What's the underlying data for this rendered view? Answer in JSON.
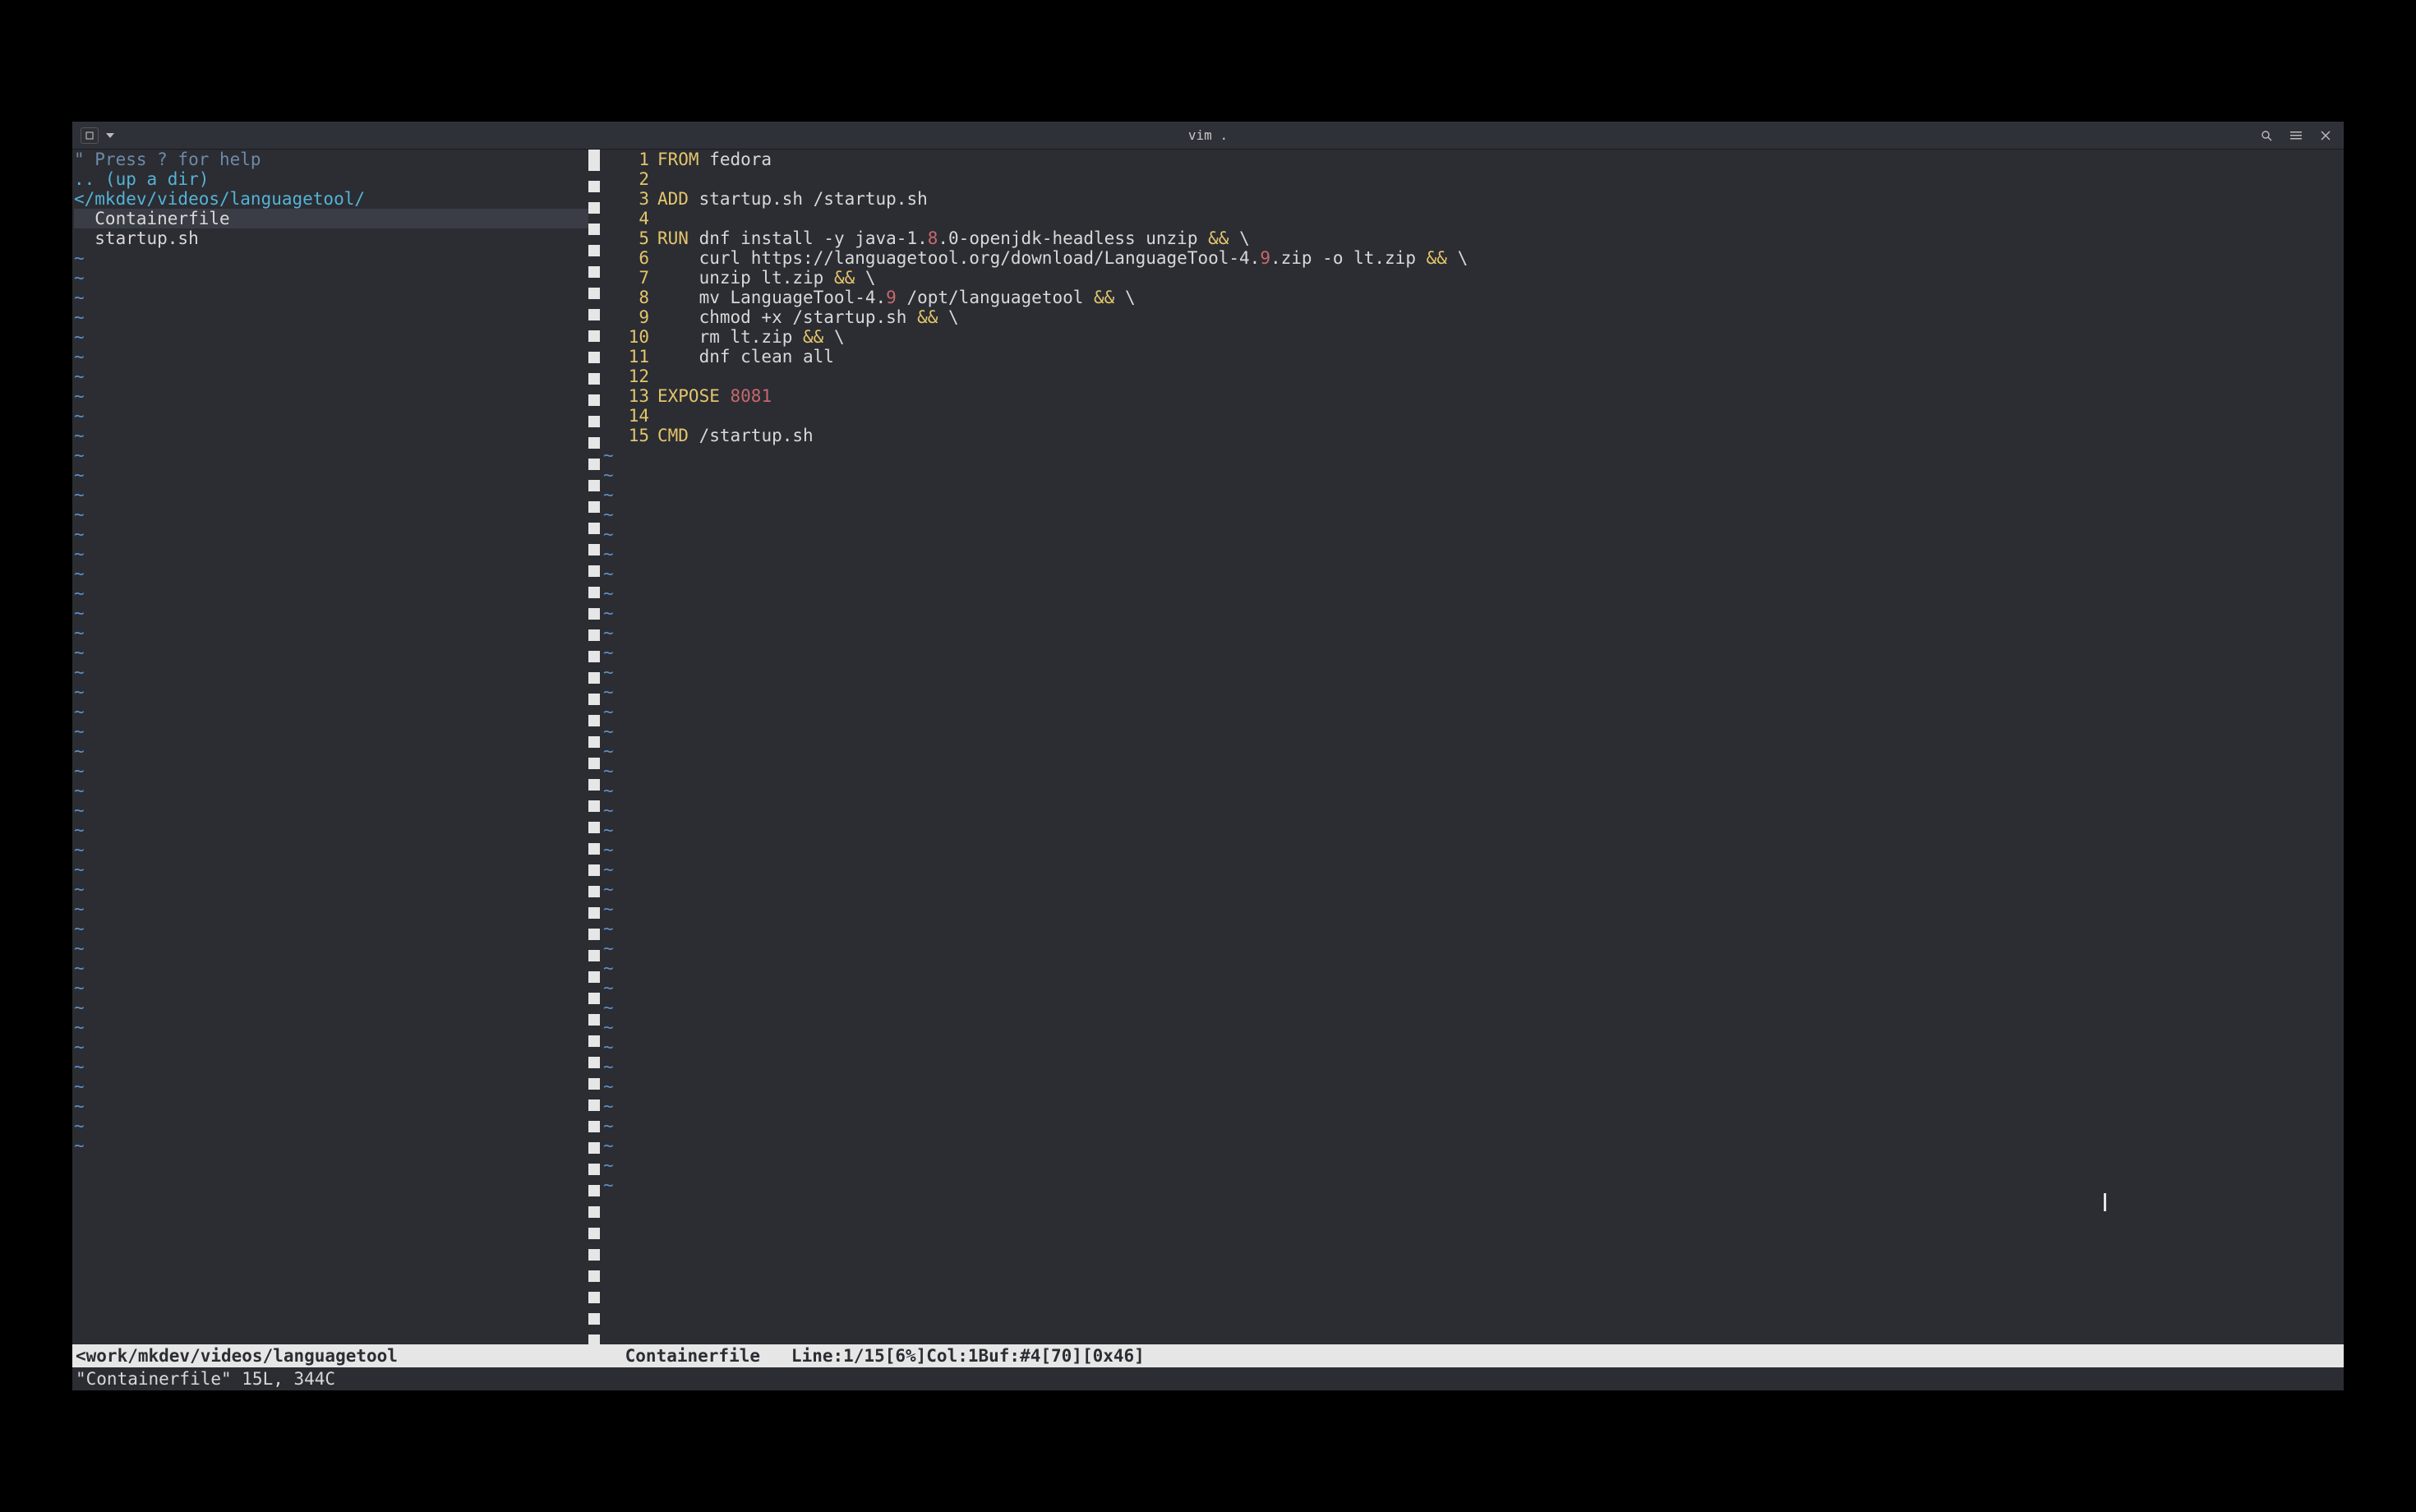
{
  "titlebar": {
    "title": "vim ."
  },
  "sidebar": {
    "help_hint": "\" Press ? for help",
    "up_dir": ".. (up a dir)",
    "cwd": "</mkdev/videos/languagetool/",
    "files": [
      "Containerfile",
      "startup.sh"
    ],
    "selected_index": 0
  },
  "editor": {
    "lines": [
      {
        "n": "1",
        "tokens": [
          [
            "kw",
            "FROM"
          ],
          [
            "txt",
            " fedora"
          ]
        ]
      },
      {
        "n": "2",
        "tokens": []
      },
      {
        "n": "3",
        "tokens": [
          [
            "kw",
            "ADD"
          ],
          [
            "txt",
            " startup.sh /startup.sh"
          ]
        ]
      },
      {
        "n": "4",
        "tokens": []
      },
      {
        "n": "5",
        "tokens": [
          [
            "kw",
            "RUN"
          ],
          [
            "txt",
            " dnf install -y java-1."
          ],
          [
            "num",
            "8"
          ],
          [
            "txt",
            ".0-openjdk-headless unzip "
          ],
          [
            "op",
            "&&"
          ],
          [
            "txt",
            " \\"
          ]
        ]
      },
      {
        "n": "6",
        "tokens": [
          [
            "txt",
            "    curl https://languagetool.org/download/LanguageTool-4."
          ],
          [
            "num",
            "9"
          ],
          [
            "txt",
            ".zip -o lt.zip "
          ],
          [
            "op",
            "&&"
          ],
          [
            "txt",
            " \\"
          ]
        ]
      },
      {
        "n": "7",
        "tokens": [
          [
            "txt",
            "    unzip lt.zip "
          ],
          [
            "op",
            "&&"
          ],
          [
            "txt",
            " \\"
          ]
        ]
      },
      {
        "n": "8",
        "tokens": [
          [
            "txt",
            "    mv LanguageTool-4."
          ],
          [
            "num",
            "9"
          ],
          [
            "txt",
            " /opt/languagetool "
          ],
          [
            "op",
            "&&"
          ],
          [
            "txt",
            " \\"
          ]
        ]
      },
      {
        "n": "9",
        "tokens": [
          [
            "txt",
            "    chmod +x /startup.sh "
          ],
          [
            "op",
            "&&"
          ],
          [
            "txt",
            " \\"
          ]
        ]
      },
      {
        "n": "10",
        "tokens": [
          [
            "txt",
            "    rm lt.zip "
          ],
          [
            "op",
            "&&"
          ],
          [
            "txt",
            " \\"
          ]
        ]
      },
      {
        "n": "11",
        "tokens": [
          [
            "txt",
            "    dnf clean all"
          ]
        ]
      },
      {
        "n": "12",
        "tokens": []
      },
      {
        "n": "13",
        "tokens": [
          [
            "kw",
            "EXPOSE"
          ],
          [
            "txt",
            " "
          ],
          [
            "num",
            "8081"
          ]
        ]
      },
      {
        "n": "14",
        "tokens": []
      },
      {
        "n": "15",
        "tokens": [
          [
            "kw",
            "CMD"
          ],
          [
            "txt",
            " /startup.sh"
          ]
        ]
      }
    ],
    "tilde_rows": 28
  },
  "status": {
    "left_path": "<work/mkdev/videos/languagetool ",
    "right_main": " Containerfile   Line:1/15[6%]Col:1Buf:#4[70][0x46]",
    "cmdline": "\"Containerfile\" 15L, 344C"
  }
}
